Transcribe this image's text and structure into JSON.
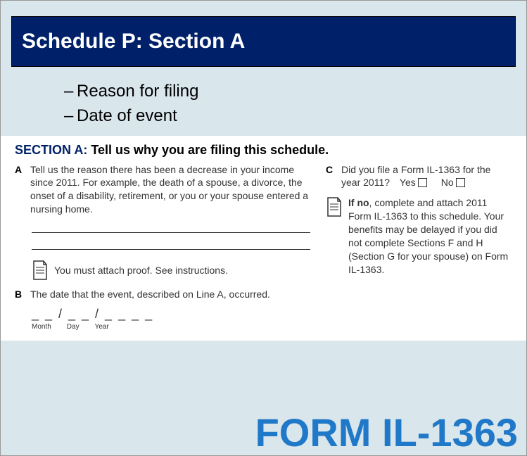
{
  "banner": {
    "title": "Schedule P: Section A"
  },
  "bullets": {
    "dash": "–",
    "items": [
      "Reason for filing",
      "Date of event"
    ]
  },
  "section": {
    "label": "SECTION A:",
    "instr": "Tell us why you are filing this schedule."
  },
  "colA": {
    "letter": "A",
    "text": "Tell us the reason there has been a decrease in your income since 2011. For example, the death of a spouse, a divorce, the onset of a disability, retirement, or you or your spouse entered a nursing home.",
    "attach": "You must attach proof. See instructions."
  },
  "colB": {
    "letter": "B",
    "text": "The date that the event, described on Line A, occurred.",
    "dateSlots": "_ _ / _ _ / _ _ _ _",
    "labels": {
      "m": "Month",
      "d": "Day",
      "y": "Year"
    }
  },
  "colC": {
    "letter": "C",
    "text": "Did you file a Form IL-1363 for the year 2011?",
    "yes": "Yes",
    "no": "No",
    "ifnoBold": "If no",
    "ifnoRest": ", complete and attach 2011 Form IL-1363 to this schedule. Your benefits may be delayed if you did not complete Sections F and H (Section G for your spouse) on Form IL-1363."
  },
  "footer": {
    "title": "FORM IL-1363"
  }
}
